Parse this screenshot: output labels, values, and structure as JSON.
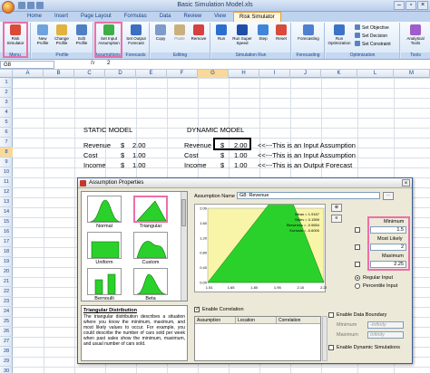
{
  "window": {
    "title": "Basic Simulation Model.xls",
    "controls": [
      "–",
      "▫",
      "×"
    ]
  },
  "ribbon": {
    "tabs": [
      "Home",
      "Insert",
      "Page Layout",
      "Formulas",
      "Data",
      "Review",
      "View",
      "Risk Simulator"
    ],
    "active_tab": "Risk Simulator",
    "groups": {
      "menu": "Menu",
      "profile": "Profile",
      "assumptions": "Assumptions",
      "forecasts": "Forecasts",
      "editing": "Editing",
      "simulation_run": "Simulation Run",
      "forecasting": "Forecasting",
      "optimization": "Optimization",
      "tools": "Tools"
    },
    "buttons": {
      "risk_simulator": "Risk Simulator",
      "new_profile": "New Profile",
      "change_profile": "Change Profile",
      "edit_profile": "Edit Profile",
      "set_input_assumption": "Set Input Assumption",
      "set_output_forecast": "Set Output Forecast",
      "copy": "Copy",
      "paste": "Paste",
      "remove": "Remove",
      "run": "Run",
      "run_super_speed": "Run Super Speed",
      "step": "Step",
      "reset": "Reset",
      "forecasting": "Forecasting",
      "run_optimization": "Run Optimization",
      "set_objective": "Set Objective",
      "set_decision": "Set Decision",
      "set_constraint": "Set Constraint",
      "analytical_tools": "Analytical Tools"
    }
  },
  "formula_bar": {
    "name_box": "G8",
    "fx": "fx",
    "value": "2"
  },
  "sheet": {
    "columns": [
      "A",
      "B",
      "C",
      "D",
      "E",
      "F",
      "G",
      "H",
      "I",
      "J",
      "K",
      "L",
      "M"
    ],
    "active_column": "G",
    "rows": [
      "1",
      "2",
      "3",
      "4",
      "5",
      "6",
      "7",
      "8",
      "9",
      "10",
      "11",
      "12",
      "13",
      "14",
      "15",
      "16",
      "17",
      "18",
      "19",
      "20",
      "21",
      "22",
      "23",
      "24",
      "25",
      "26",
      "27",
      "28",
      "29",
      "30"
    ],
    "active_row": "8",
    "static_model": {
      "heading": "STATIC MODEL",
      "rows": [
        {
          "label": "Revenue",
          "currency": "$",
          "value": "2.00"
        },
        {
          "label": "Cost",
          "currency": "$",
          "value": "1.00"
        },
        {
          "label": "Income",
          "currency": "$",
          "value": "1.00"
        }
      ]
    },
    "dynamic_model": {
      "heading": "DYNAMIC MODEL",
      "rows": [
        {
          "label": "Revenue",
          "currency": "$",
          "value": "2.00",
          "note": "<<---This is an Input Assumption"
        },
        {
          "label": "Cost",
          "currency": "$",
          "value": "1.00",
          "note": "<<---This is an Input Assumption"
        },
        {
          "label": "Income",
          "currency": "$",
          "value": "1.00",
          "note": "<<---This is an Output Forecast"
        }
      ]
    }
  },
  "dialog": {
    "title": "Assumption Properties",
    "close": "×",
    "distributions": [
      {
        "name": "Normal",
        "shape": "bell"
      },
      {
        "name": "Triangular",
        "shape": "triangle"
      },
      {
        "name": "Uniform",
        "shape": "flat"
      },
      {
        "name": "Custom",
        "shape": "hump"
      },
      {
        "name": "Bernoulli",
        "shape": "bars"
      },
      {
        "name": "Beta",
        "shape": "beta"
      }
    ],
    "selected_distribution": "Triangular",
    "description": {
      "heading": "Triangular Distribution",
      "text": "The triangular distribution describes a situation where you know the minimum, maximum, and most likely values to occur. For example, you could describe the number of cars sold per week when past sales show the minimum, maximum, and usual number of cars sold."
    },
    "assumption_name_label": "Assumption Name",
    "assumption_name_value": "G8: Revenue",
    "stats": [
      "Mean = 1.9167",
      "Stdev = 0.1559",
      "Skewness = -0.5654",
      "Kurtosis = -0.6000"
    ],
    "chart": {
      "y_ticks": [
        "2.00",
        "1.60",
        "1.20",
        "0.80",
        "0.40",
        "0.00"
      ],
      "x_ticks": [
        "1.51",
        "1.65",
        "1.80",
        "1.95",
        "2.10",
        "2.25"
      ],
      "x_range": [
        1.5,
        2.25
      ],
      "y_range": [
        0,
        2
      ],
      "triangle": {
        "min": 1.5,
        "most_likely": 2.0,
        "max": 2.25
      }
    },
    "params": {
      "minimum_label": "Minimum",
      "minimum_value": "1.5",
      "most_likely_label": "Most Likely",
      "most_likely_value": "2",
      "maximum_label": "Maximum",
      "maximum_value": "2.25"
    },
    "regular_input": "Regular Input",
    "percentile_input": "Percentile Input",
    "enable_correlation": "Enable Correlation",
    "correlation_columns": [
      "Assumption",
      "Location",
      "Correlation"
    ],
    "enable_data_boundary": "Enable Data Boundary",
    "boundary_min_label": "Minimum",
    "boundary_max_label": "Maximum",
    "boundary_placeholder": "-Infinity",
    "boundary_max_placeholder": "Infinity",
    "enable_dynamic_simulations": "Enable Dynamic Simulations",
    "colors": {
      "accent": "#ec6fa8",
      "plot_bg": "#f8f4a8",
      "triangle": "#2bd12b"
    }
  }
}
